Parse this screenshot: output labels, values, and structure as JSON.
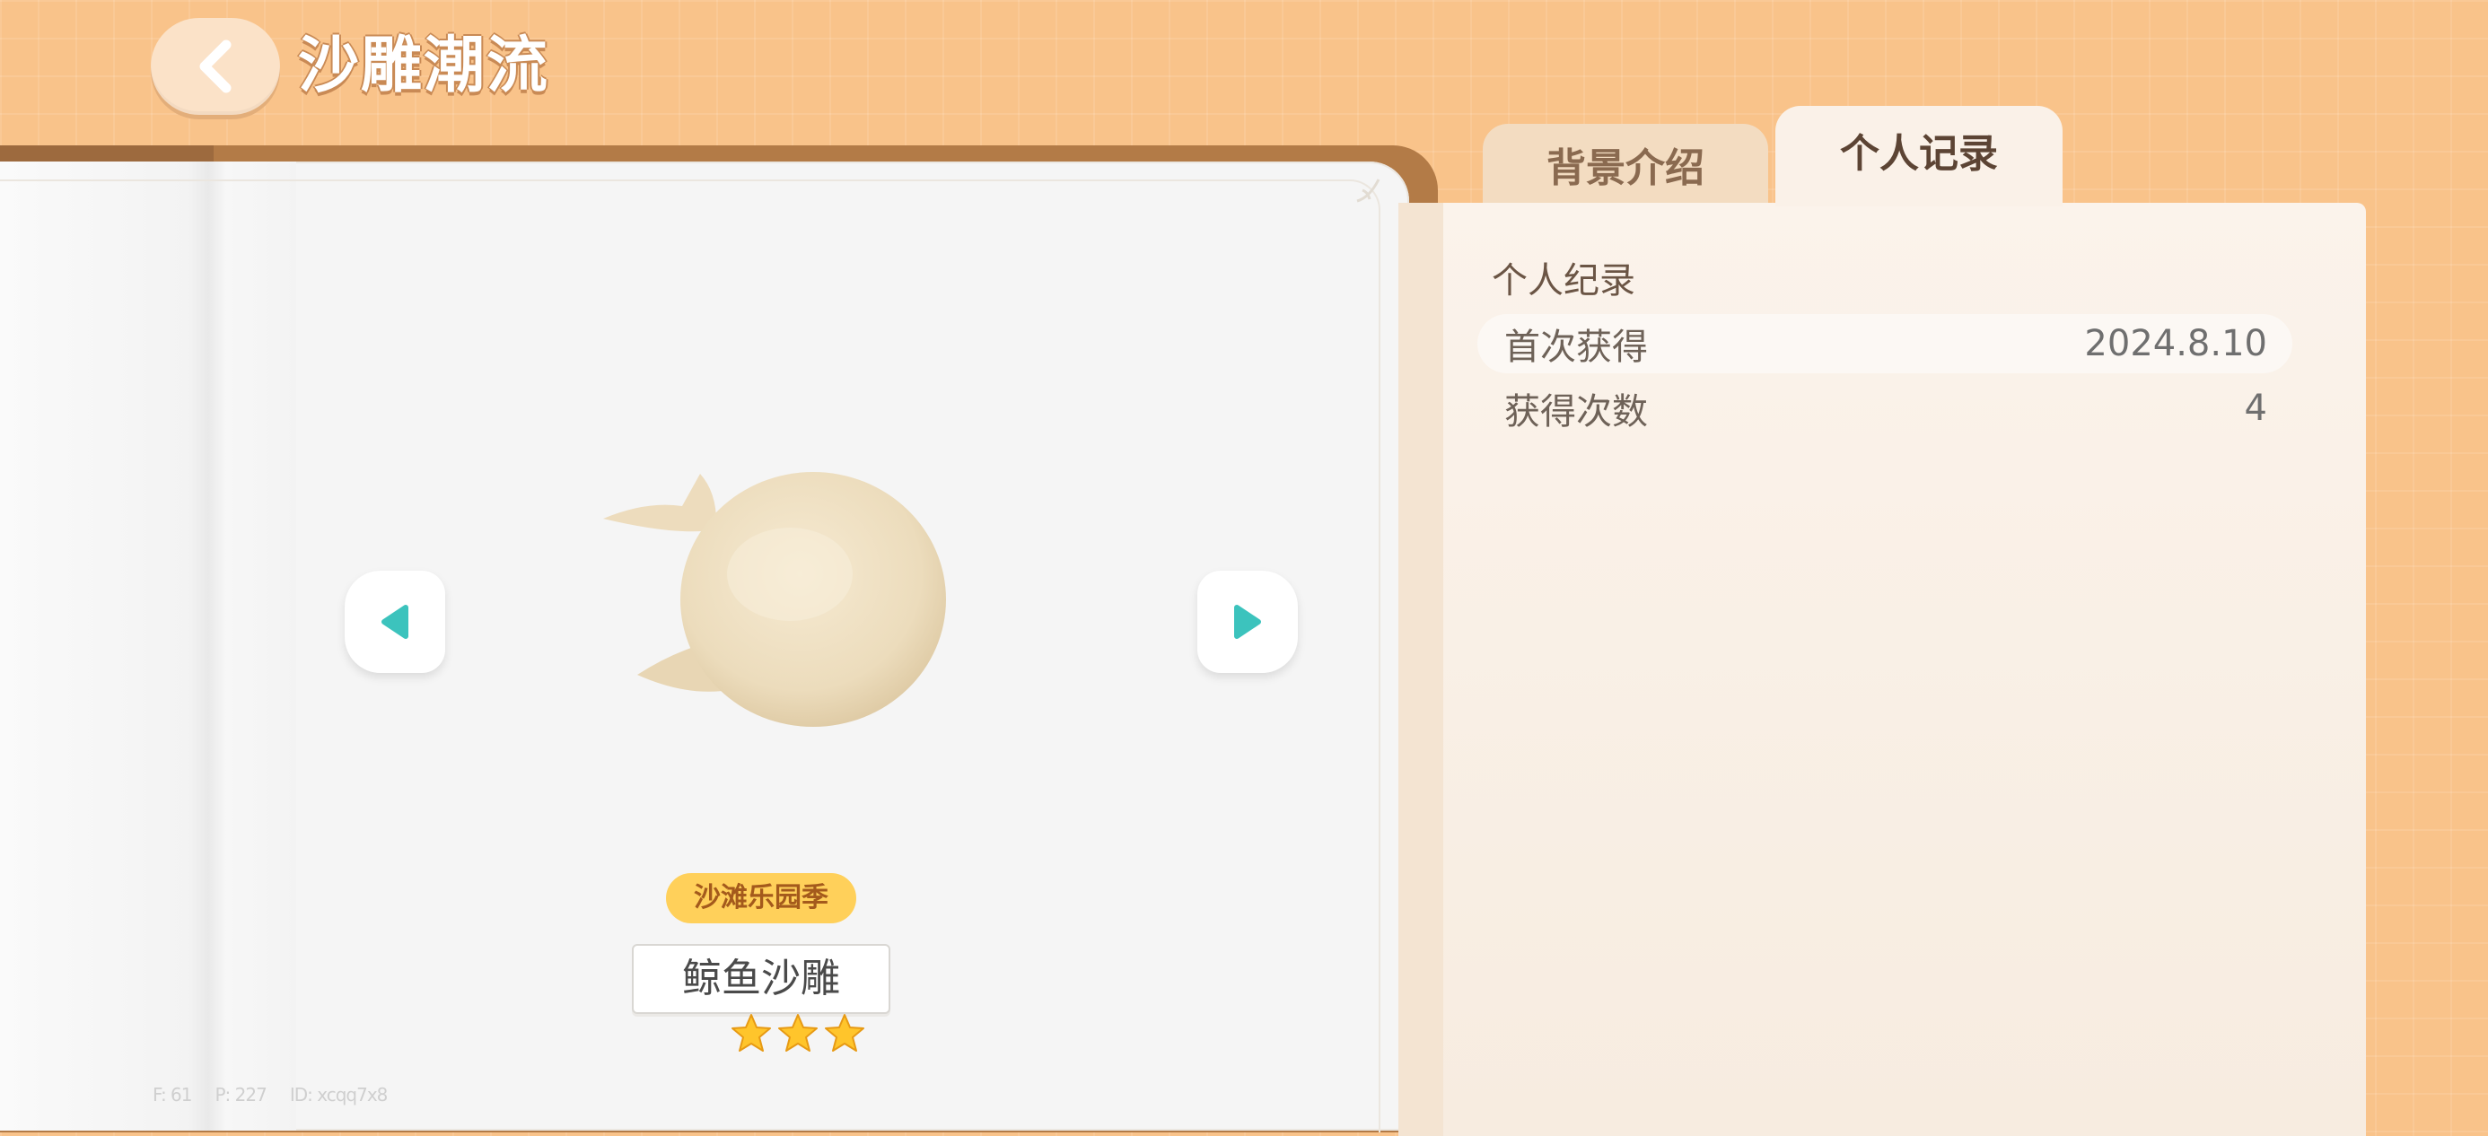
{
  "header": {
    "title": "沙雕潮流",
    "back_icon": "chevron-left-icon"
  },
  "item": {
    "season_tag": "沙滩乐园季",
    "name": "鲸鱼沙雕",
    "stars": 3,
    "stars_max": 3
  },
  "debug": {
    "f": "F: 61",
    "p": "P: 227",
    "id": "ID: xcqq7x8"
  },
  "tabs": [
    {
      "label": "背景介绍",
      "active": false
    },
    {
      "label": "个人记录",
      "active": true
    }
  ],
  "panel": {
    "section_title": "个人纪录",
    "rows": [
      {
        "label": "首次获得",
        "value": "2024.8.10"
      },
      {
        "label": "获得次数",
        "value": "4"
      }
    ]
  },
  "colors": {
    "background": "#f9c38a",
    "accent_teal": "#3cc3bd",
    "tag_yellow": "#ffd05a",
    "panel": "#faf1e8"
  }
}
